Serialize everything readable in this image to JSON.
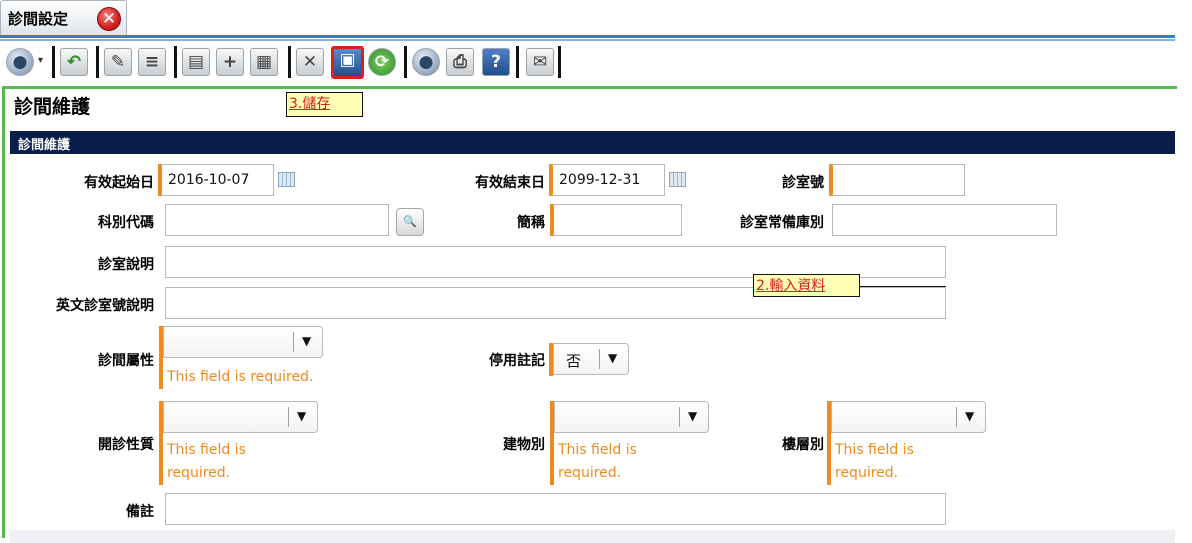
{
  "tab": {
    "label": "診間設定",
    "close_glyph": "✕"
  },
  "toolbar": {
    "buttons": [
      {
        "name": "globe-menu-icon"
      },
      {
        "name": "undo-icon"
      },
      {
        "name": "edit-icon"
      },
      {
        "name": "list-icon"
      },
      {
        "name": "add-form-icon"
      },
      {
        "name": "plus-icon"
      },
      {
        "name": "grid-icon"
      },
      {
        "name": "delete-icon"
      },
      {
        "name": "save-icon"
      },
      {
        "name": "refresh-icon"
      },
      {
        "name": "globe-icon"
      },
      {
        "name": "print-icon"
      },
      {
        "name": "help-icon"
      },
      {
        "name": "export-icon"
      }
    ]
  },
  "page": {
    "title": "診間維護",
    "section_title": "診間維護"
  },
  "form": {
    "start_date": {
      "label": "有效起始日",
      "value": "2016-10-07"
    },
    "end_date": {
      "label": "有效結束日",
      "value": "2099-12-31"
    },
    "room_no": {
      "label": "診室號",
      "value": ""
    },
    "dept_code": {
      "label": "科別代碼",
      "value": ""
    },
    "short_name": {
      "label": "簡稱",
      "value": ""
    },
    "warehouse": {
      "label": "診室常備庫別",
      "value": ""
    },
    "room_desc": {
      "label": "診室說明",
      "value": ""
    },
    "room_desc_en": {
      "label": "英文診室號說明",
      "value": ""
    },
    "room_attr": {
      "label": "診間屬性",
      "value": "",
      "error": "This field is required."
    },
    "disabled_flag": {
      "label": "停用註記",
      "value": "否"
    },
    "clinic_nature": {
      "label": "開診性質",
      "value": "",
      "error_line1": "This field is",
      "error_line2": "required."
    },
    "building": {
      "label": "建物別",
      "value": "",
      "error_line1": "This field is",
      "error_line2": "required."
    },
    "floor": {
      "label": "樓層別",
      "value": "",
      "error_line1": "This field is",
      "error_line2": "required."
    },
    "remarks": {
      "label": "備註",
      "value": ""
    }
  },
  "callouts": {
    "save_step": "3.儲存",
    "input_step": "2.輸入資料"
  },
  "colors": {
    "tab_blue": "#2e7fd1",
    "panel_green": "#55b94d",
    "section_navy": "#091d4a",
    "required_orange": "#f08a1c",
    "save_highlight": "#e01c1c",
    "callout_yellow": "#ffffb5"
  }
}
